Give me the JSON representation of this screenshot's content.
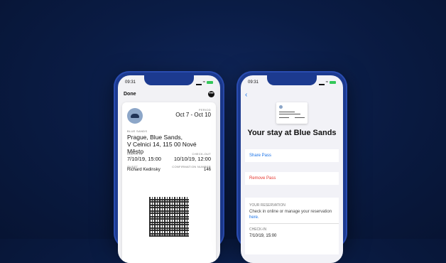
{
  "status": {
    "time": "09:31"
  },
  "left_screen": {
    "done_label": "Done",
    "more_icon": "ellipsis-icon",
    "pass": {
      "period_label": "PERIOD",
      "period_value": "Oct 7 - Oct 10",
      "brand_label": "BLUE SANDS",
      "hotel_line1": "Prague, Blue Sands,",
      "hotel_line2": "V Celnici 14, 115 00 Nové Město",
      "checkin_label": "CHECK-IN",
      "checkin_value": "7/10/19, 15:00",
      "checkout_label": "CHECK-OUT",
      "checkout_value": "10/10/19, 12:00",
      "guest_label": "GUEST",
      "guest_value": "Richard Kedinsky",
      "confirmation_label": "CONFIRMATION NUMBER",
      "confirmation_value": "146"
    }
  },
  "right_screen": {
    "back_icon": "chevron-left-icon",
    "title": "Your stay at Blue Sands",
    "share_label": "Share Pass",
    "remove_label": "Remove Pass",
    "reservation_label": "YOUR RESERVATION",
    "reservation_text": "Check in online or manage your reservation",
    "reservation_link": "here.",
    "checkin_label": "CHECK-IN",
    "checkin_value": "7/10/19, 15:00"
  },
  "colors": {
    "link": "#1a73e8",
    "destructive": "#e5372f",
    "phone_frame": "#1c3a8f",
    "background": "#0a1c45"
  }
}
